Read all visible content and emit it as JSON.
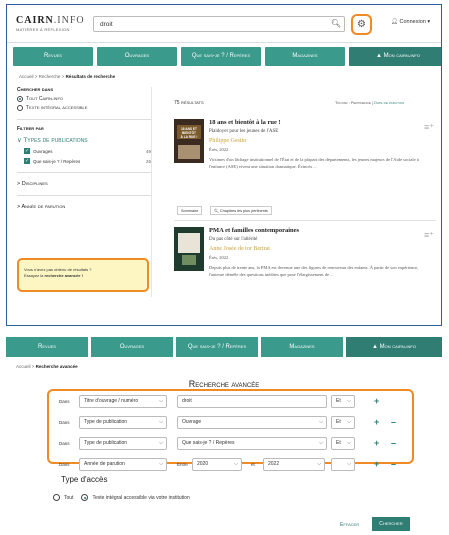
{
  "top": {
    "logo_line1": "CAIRN",
    "logo_line1b": ".INFO",
    "logo_line2": "MATIÈRES À RÉFLEXION",
    "search_value": "droit",
    "connexion": "Connexion"
  },
  "nav": [
    "Revues",
    "Ouvrages",
    "Que sais-je ? / Repères",
    "Magazines",
    "Mon cairn.info"
  ],
  "breadcrumb": {
    "home": "Accueil",
    "search": "Recherche",
    "current": "Résultats de recherche"
  },
  "sidebar": {
    "search_in": "Chercher dans",
    "opt_all": "Tout Cairn.info",
    "opt_full": "Texte intégral accessible",
    "filter_by": "Filtrer par",
    "pub_types": "Types de publications",
    "types": [
      {
        "label": "Ouvrages",
        "count": "49"
      },
      {
        "label": "Que sais-je ? / Repères",
        "count": "26"
      }
    ],
    "disciplines": "Disciplines",
    "year": "Année de parution",
    "notice_line1": "Vous n'avez pas obtenu de résultats ?",
    "notice_line2a": "Essayez la ",
    "notice_line2b": "recherche avancée !"
  },
  "results": {
    "count": "75 résultats",
    "sort_label": "Tri par : Pertinence",
    "sort_alt": "Date de parution",
    "items": [
      {
        "title": "18 ans et bientôt à la rue !",
        "subtitle": "Plaidoyer pour les jeunes de l'ASE",
        "author": "Philippe Gestin",
        "publisher": "Érès, 2022",
        "description": "Victimes d'un lâchage institutionnel de l'État et de la plupart des départements, les jeunes majeurs de l'Aide sociale à l'enfance (ASE) vivent une situation dramatique. Évincés ...",
        "btn_summary": "Sommaire",
        "btn_relevant": "Chapitres les plus pertinents"
      },
      {
        "title": "PMA et familles contemporaines",
        "subtitle": "Du pas côté sur l'altérité",
        "author": "Anne Josée de tor Bertrat",
        "publisher": "Érès, 2022",
        "description": "Depuis plus de trente ans, la PMA est devenue une des figures de renouveau des enfants. À partir de son expérience, l'auteure démêle des questions inédites que pose l'élargissement de ..."
      }
    ]
  },
  "advanced": {
    "breadcrumb_home": "Accueil",
    "breadcrumb_current": "Recherche avancée",
    "title": "Recherche avancée",
    "rows": [
      {
        "dans": "Dans",
        "field": "Titre d'ouvrage / numéro",
        "value": "droit",
        "op": "Et"
      },
      {
        "dans": "Dans",
        "field": "Type de publication",
        "value": "Ouvrage",
        "op": "Et"
      },
      {
        "dans": "Dans",
        "field": "Type de publication",
        "value": "Que sais-je ? / Repères",
        "op": "Et"
      },
      {
        "dans": "Dans",
        "field": "Année de parution",
        "entre": "Entre",
        "from": "2020",
        "et": "et",
        "to": "2022",
        "op": ""
      }
    ],
    "access_title": "Type d'accès",
    "access_all": "Tout",
    "access_full": "Texte intégral accessible via votre institution",
    "clear": "Effacer",
    "search": "Chercher"
  },
  "colors": {
    "teal": "#3a9a8c",
    "teal_dark": "#2f7d73",
    "orange": "#f08a24",
    "gold": "#c9a238"
  }
}
